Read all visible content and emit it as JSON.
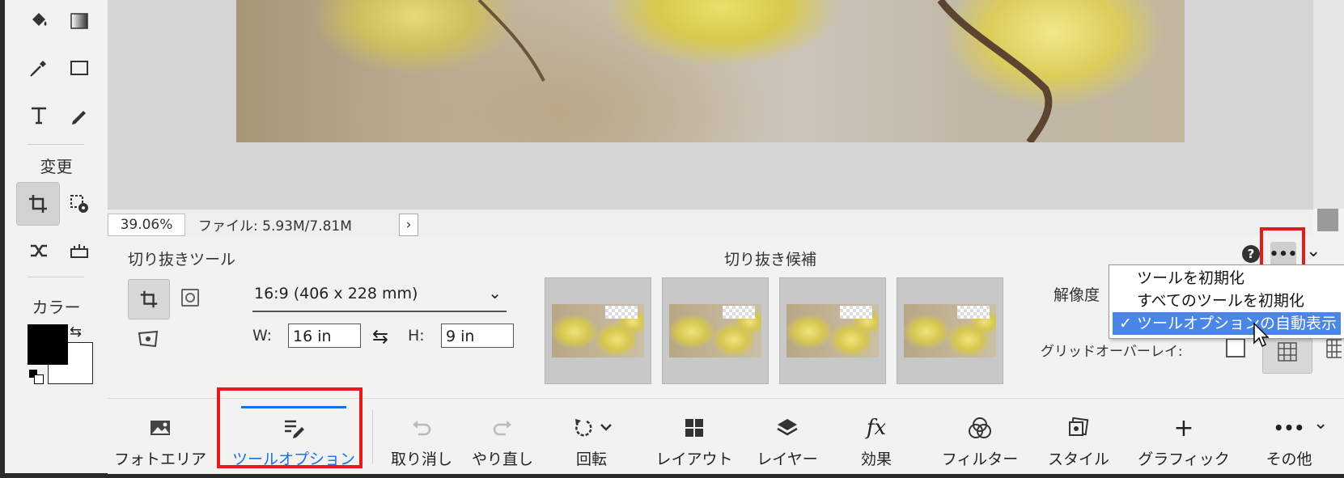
{
  "toolbar": {
    "tools": [
      {
        "icon": "paint-bucket-icon"
      },
      {
        "icon": "gradient-icon"
      },
      {
        "icon": "eyedropper-icon"
      },
      {
        "icon": "rectangle-icon"
      },
      {
        "icon": "text-icon"
      },
      {
        "icon": "pencil-icon"
      },
      {
        "icon": "crop-icon",
        "active": true
      },
      {
        "icon": "recompose-icon"
      },
      {
        "icon": "content-aware-move-icon"
      },
      {
        "icon": "straighten-icon"
      }
    ],
    "transform_label": "変更",
    "color_label": "カラー",
    "foreground_color": "#000000",
    "background_color": "#ffffff"
  },
  "status": {
    "zoom": "39.06%",
    "file_info": "ファイル: 5.93M/7.81M"
  },
  "tool_options": {
    "title": "切り抜きツール",
    "preset": "16:9 (406 x 228 mm)",
    "width_label": "W:",
    "width_value": "16 in",
    "height_label": "H:",
    "height_value": "9 in",
    "suggestions_title": "切り抜き候補",
    "resolution_label": "解像度",
    "grid_overlay_label": "グリッドオーバーレイ:"
  },
  "menu": {
    "items": [
      {
        "label": "ツールを初期化"
      },
      {
        "label": "すべてのツールを初期化"
      },
      {
        "label": "ツールオプションの自動表示",
        "checked": true
      }
    ]
  },
  "bottom_bar": {
    "items": [
      {
        "label": "フォトエリア",
        "icon": "photo-bin-icon"
      },
      {
        "label": "ツールオプション",
        "icon": "tool-options-icon",
        "active": true
      },
      {
        "label": "取り消し",
        "icon": "undo-icon"
      },
      {
        "label": "やり直し",
        "icon": "redo-icon"
      },
      {
        "label": "回転",
        "icon": "rotate-icon"
      },
      {
        "label": "レイアウト",
        "icon": "layout-icon"
      },
      {
        "label": "レイヤー",
        "icon": "layers-icon"
      },
      {
        "label": "効果",
        "icon": "fx-icon"
      },
      {
        "label": "フィルター",
        "icon": "filter-icon"
      },
      {
        "label": "スタイル",
        "icon": "styles-icon"
      },
      {
        "label": "グラフィック",
        "icon": "graphics-icon"
      },
      {
        "label": "その他",
        "icon": "more-icon"
      }
    ]
  },
  "colors": {
    "accent": "#1473e6",
    "highlight": "#e31b1b",
    "menu_selection": "#4a86e8"
  }
}
